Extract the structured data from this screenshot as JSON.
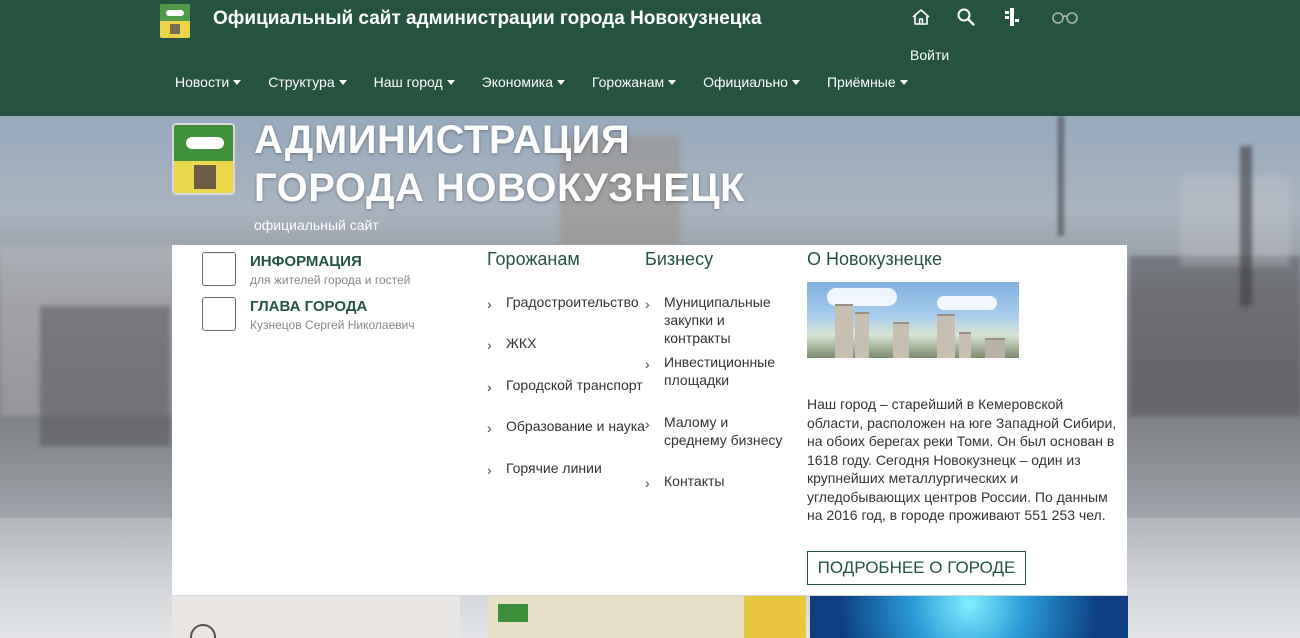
{
  "header": {
    "site_title": "Официальный сайт администрации города Новокузнецка",
    "login_label": "Войти",
    "icons": [
      "home-icon",
      "search-icon",
      "sitemap-icon",
      "glasses-icon"
    ]
  },
  "nav": {
    "items": [
      {
        "label": "Новости"
      },
      {
        "label": "Структура"
      },
      {
        "label": "Наш город"
      },
      {
        "label": "Экономика"
      },
      {
        "label": "Горожанам"
      },
      {
        "label": "Официально"
      },
      {
        "label": "Приёмные"
      }
    ]
  },
  "hero": {
    "title_line1": "АДМИНИСТРАЦИЯ",
    "title_line2": "ГОРОДА НОВОКУЗНЕЦК",
    "subtitle": "официальный сайт"
  },
  "side_links": [
    {
      "title": "ИНФОРМАЦИЯ",
      "desc": "для жителей города и гостей"
    },
    {
      "title": "ГЛАВА ГОРОДА",
      "desc": "Кузнецов Сергей Николаевич"
    }
  ],
  "citizens": {
    "heading": "Горожанам",
    "items": [
      "Градостроительство",
      "ЖКХ",
      "Городской транспорт",
      "Образование и наука",
      "Горячие линии"
    ]
  },
  "business": {
    "heading": "Бизнесу",
    "items": [
      "Муниципальные закупки и контракты",
      "Инвестиционные площадки",
      "Малому и среднему бизнесу",
      "Контакты"
    ]
  },
  "about": {
    "heading": "О Новокузнецке",
    "text": "Наш город – старейший в Кемеровской области, расположен на юге Западной Сибири, на обоих берегах реки Томи. Он был основан в 1618 году. Сегодня Новокузнецк – один из крупнейших металлургических и угледобывающих центров России. По данным на 2016 год, в городе проживают 551 253 чел.",
    "button": "ПОДРОБНЕЕ О ГОРОДЕ"
  },
  "colors": {
    "header_bg": "#245440",
    "accent": "#245440",
    "panel_bg": "#ffffff"
  }
}
